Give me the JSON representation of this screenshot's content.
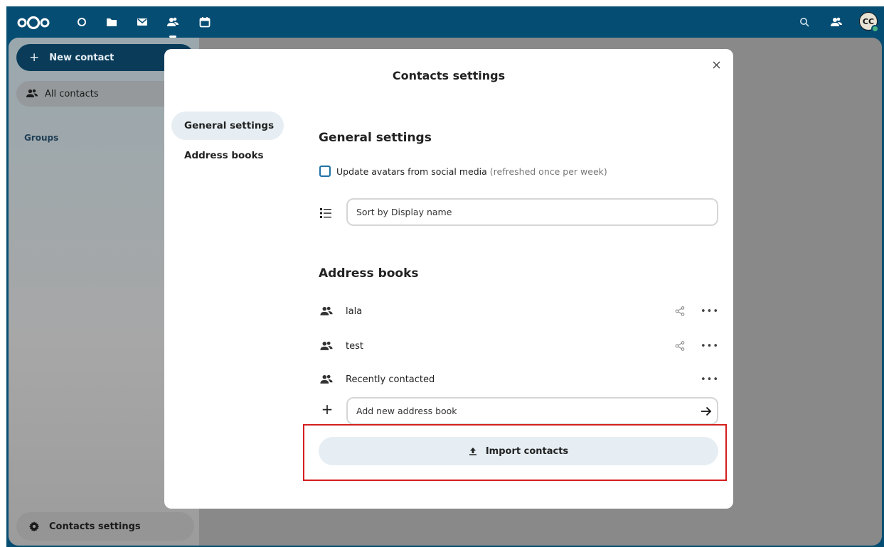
{
  "topbar": {
    "apps": [
      "logo-icon",
      "dashboard-icon",
      "files-icon",
      "mail-icon",
      "contacts-icon",
      "calendar-icon"
    ],
    "right_icons": [
      "search-icon",
      "contacts-menu-icon"
    ],
    "avatar_initials": "CC"
  },
  "navigation": {
    "new_contact_label": "New contact",
    "all_contacts_label": "All contacts",
    "groups_heading": "Groups",
    "settings_label": "Contacts settings"
  },
  "modal": {
    "title": "Contacts settings",
    "sidebar": [
      {
        "label": "General settings",
        "active": true
      },
      {
        "label": "Address books",
        "active": false
      }
    ],
    "general": {
      "heading": "General settings",
      "avatar_checkbox_label": "Update avatars from social media",
      "avatar_checkbox_hint": "(refreshed once per week)",
      "avatar_checkbox_checked": false,
      "sort_value": "Sort by Display name"
    },
    "address_books": {
      "heading": "Address books",
      "items": [
        {
          "name": "lala",
          "shareable": true
        },
        {
          "name": "test",
          "shareable": true
        },
        {
          "name": "Recently contacted",
          "shareable": false
        }
      ],
      "add_placeholder": "Add new address book"
    },
    "import_label": "Import contacts"
  },
  "colors": {
    "header_bg": "#064d73",
    "primary_light": "#e6eef3",
    "checkbox_border": "#1e72a8",
    "highlight": "#d41e1e"
  }
}
